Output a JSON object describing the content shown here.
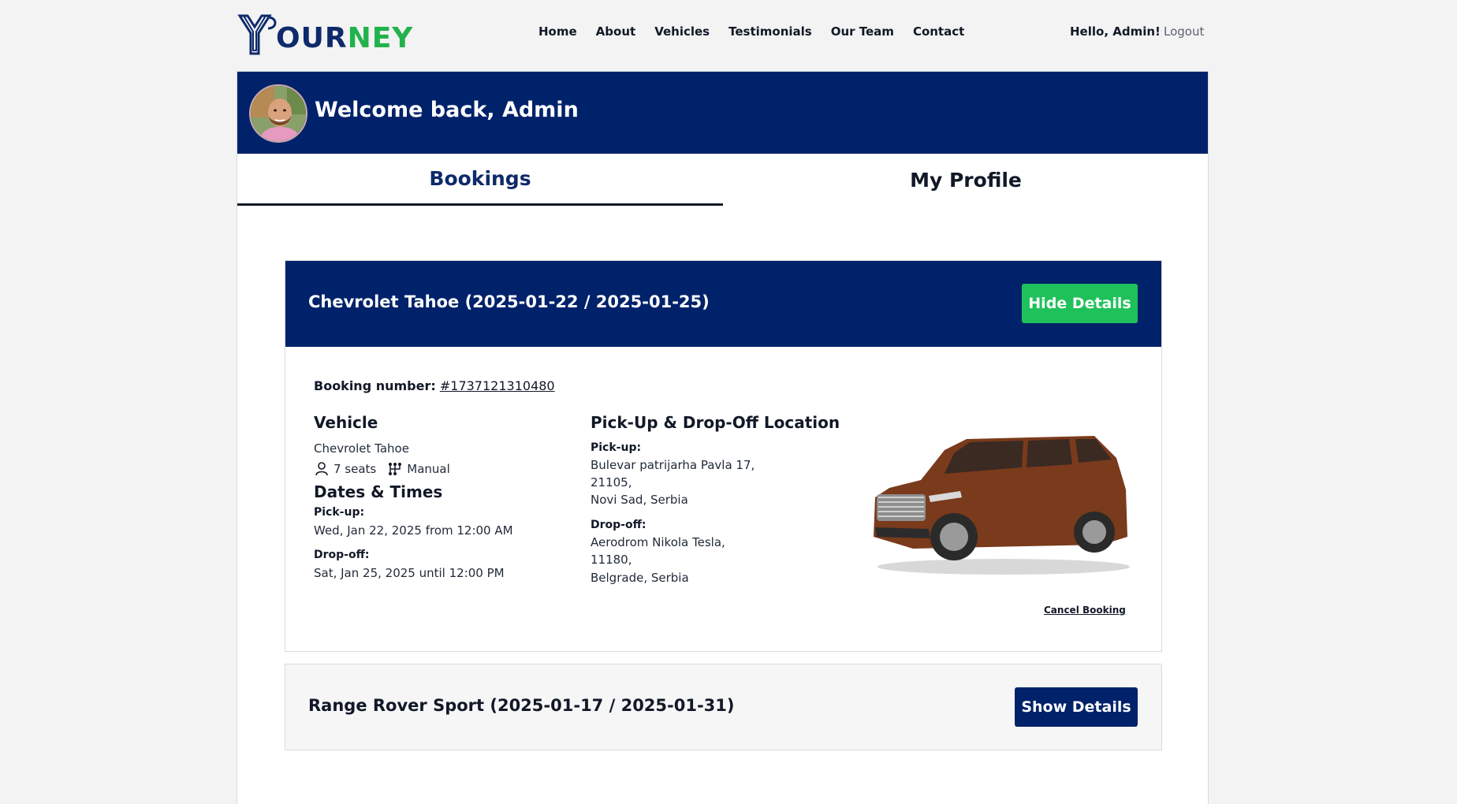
{
  "brand": {
    "logo_part1": "OUR",
    "logo_part2": "NEY",
    "logo_initial": "Y"
  },
  "nav": {
    "items": [
      {
        "label": "Home"
      },
      {
        "label": "About"
      },
      {
        "label": "Vehicles"
      },
      {
        "label": "Testimonials"
      },
      {
        "label": "Our Team"
      },
      {
        "label": "Contact"
      }
    ],
    "greeting": "Hello, Admin!",
    "logout": "Logout"
  },
  "welcome": {
    "text": "Welcome back, Admin"
  },
  "tabs": [
    {
      "label": "Bookings",
      "active": true
    },
    {
      "label": "My Profile",
      "active": false
    }
  ],
  "bookings": [
    {
      "title": "Chevrolet Tahoe (2025-01-22 / 2025-01-25)",
      "toggle_label": "Hide Details",
      "expanded": true,
      "booking_number_label": "Booking number:",
      "booking_number": "#1737121310480",
      "vehicle_heading": "Vehicle",
      "vehicle_name": "Chevrolet Tahoe",
      "seats": "7 seats",
      "transmission": "Manual",
      "dates_heading": "Dates & Times",
      "pickup_label": "Pick-up:",
      "pickup_time": "Wed, Jan 22, 2025 from 12:00 AM",
      "dropoff_label": "Drop-off:",
      "dropoff_time": "Sat, Jan 25, 2025 until 12:00 PM",
      "location_heading": "Pick-Up & Drop-Off Location",
      "pickup_address": [
        "Bulevar patrijarha Pavla 17,",
        "21105,",
        "Novi Sad, Serbia"
      ],
      "dropoff_address": [
        "Aerodrom Nikola Tesla,",
        "11180,",
        "Belgrade, Serbia"
      ],
      "cancel_label": "Cancel Booking",
      "car_color": "#7a3a1c"
    },
    {
      "title": "Range Rover Sport (2025-01-17 / 2025-01-31)",
      "toggle_label": "Show Details",
      "expanded": false
    }
  ],
  "colors": {
    "navy": "#00226a",
    "green": "#1fc15a",
    "page_bg": "#f3f3f3"
  },
  "icons": [
    "person-icon",
    "gear-shift-icon",
    "logo-icon"
  ]
}
